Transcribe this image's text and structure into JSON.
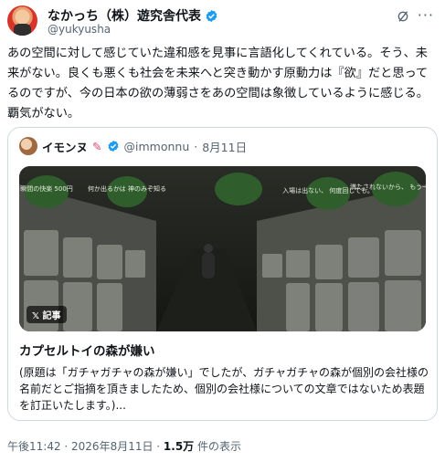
{
  "post": {
    "display_name": "なかっち（株）遊究舎代表",
    "handle": "@yukyusha",
    "text": "あの空間に対して感じていた違和感を見事に言語化してくれている。そう、未来がない。良くも悪くも社会を未来へと突き動かす原動力は『欲』だと思ってるのですが、今の日本の欲の薄弱さをあの空間は象徴しているように感じる。覇気がない。"
  },
  "quote": {
    "display_name": "イモンヌ",
    "handle": "@immonnu",
    "separator": "·",
    "date": "8月11日",
    "badge": "記事",
    "title": "カプセルトイの森が嫌い",
    "description": "(原題は「ガチャガチャの森が嫌い」でしたが、ガチャガチャの森が個別の会社様の名前だとご指摘を頂きましたため、個別の会社様についての文章ではないため表題を訂正いたします。)..."
  },
  "image_signs": [
    "瞬間の快楽 500円",
    "何か出るかは 神のみぞ知る",
    "入場は出ない、 何度回しても。",
    "満たされないから、 もう一回。"
  ],
  "footer": {
    "time": "午後11:42 · 2026年8月11日 · ",
    "views": "1.5万",
    "views_suffix": " 件の表示"
  },
  "colors": {
    "verified": "#1d9bf0",
    "muted": "#536471",
    "border": "#cfd9de"
  },
  "icons": [
    "verified-badge-icon",
    "grok-icon",
    "more-icon",
    "x-logo-icon"
  ]
}
